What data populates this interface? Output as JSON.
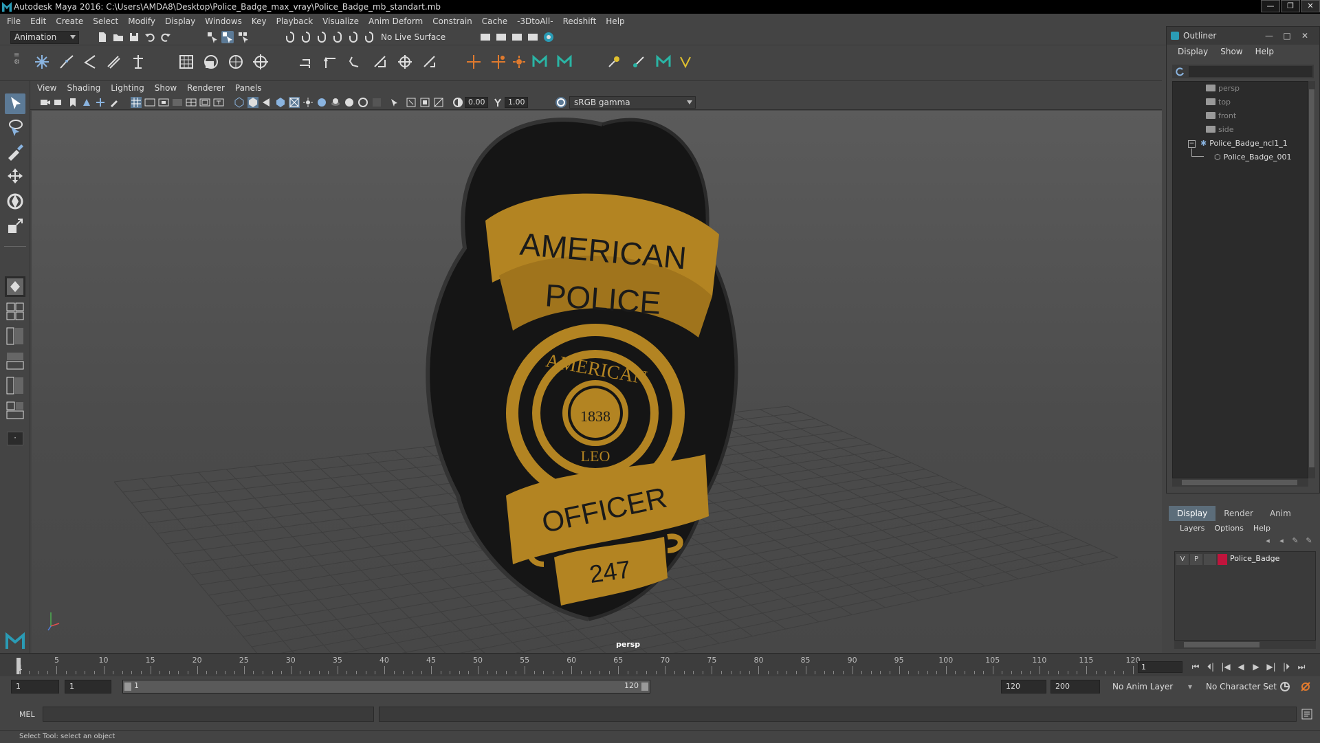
{
  "window": {
    "title": "Autodesk Maya 2016: C:\\Users\\AMDA8\\Desktop\\Police_Badge_max_vray\\Police_Badge_mb_standart.mb",
    "min": "—",
    "max": "❐",
    "close": "✕"
  },
  "menubar": [
    "File",
    "Edit",
    "Create",
    "Select",
    "Modify",
    "Display",
    "Windows",
    "Key",
    "Playback",
    "Visualize",
    "Anim Deform",
    "Constrain",
    "Cache",
    "-3DtoAll-",
    "Redshift",
    "Help"
  ],
  "statusline": {
    "mode": "Animation",
    "live_surface": "No Live Surface"
  },
  "viewport": {
    "menu": [
      "View",
      "Shading",
      "Lighting",
      "Show",
      "Renderer",
      "Panels"
    ],
    "exposure": "0.00",
    "gamma": "1.00",
    "color_space": "sRGB gamma",
    "camera_label": "persp"
  },
  "badge": {
    "line1": "AMERICAN",
    "line2": "POLICE",
    "ring_top": "AMERICAN",
    "year": "1838",
    "ring_bottom": "LEO",
    "line3": "OFFICER",
    "number": "247",
    "colors": {
      "gold": "#b38422",
      "dark": "#151515"
    }
  },
  "timeline": {
    "start_tick": "1",
    "ticks": [
      5,
      10,
      15,
      20,
      25,
      30,
      35,
      40,
      45,
      50,
      55,
      60,
      65,
      70,
      75,
      80,
      85,
      90,
      95,
      100,
      105,
      110,
      115,
      120
    ],
    "ticks_text": [
      "5",
      "10",
      "15",
      "20",
      "25",
      "30",
      "35",
      "40",
      "45",
      "50",
      "55",
      "60",
      "65",
      "70",
      "75",
      "80",
      "85",
      "90",
      "95",
      "100",
      "105",
      "110",
      "115",
      "120"
    ],
    "current_frame": "1",
    "controls": [
      "⏮",
      "⏴|",
      "|◀",
      "◀",
      "▶",
      "▶|",
      "|⏵",
      "⏭"
    ]
  },
  "range": {
    "start": "1",
    "playback_start": "1",
    "slider_start": "1",
    "slider_end": "120",
    "playback_end": "120",
    "end": "200",
    "anim_layer": "No Anim Layer",
    "char_set": "No Character Set"
  },
  "command": {
    "label": "MEL",
    "help_text": "Select Tool: select an object"
  },
  "outliner": {
    "title": "Outliner",
    "menu": [
      "Display",
      "Show",
      "Help"
    ],
    "nodes": [
      {
        "label": "persp",
        "dim": true
      },
      {
        "label": "top",
        "dim": true
      },
      {
        "label": "front",
        "dim": true
      },
      {
        "label": "side",
        "dim": true
      },
      {
        "label": "Police_Badge_ncl1_1",
        "dim": false
      },
      {
        "label": "Police_Badge_001",
        "dim": false
      }
    ],
    "expander": "−"
  },
  "layers": {
    "tabs": [
      "Display",
      "Render",
      "Anim"
    ],
    "menu": [
      "Layers",
      "Options",
      "Help"
    ],
    "layer": {
      "v": "V",
      "p": "P",
      "name": "Police_Badge",
      "color": "#c0143c"
    }
  }
}
